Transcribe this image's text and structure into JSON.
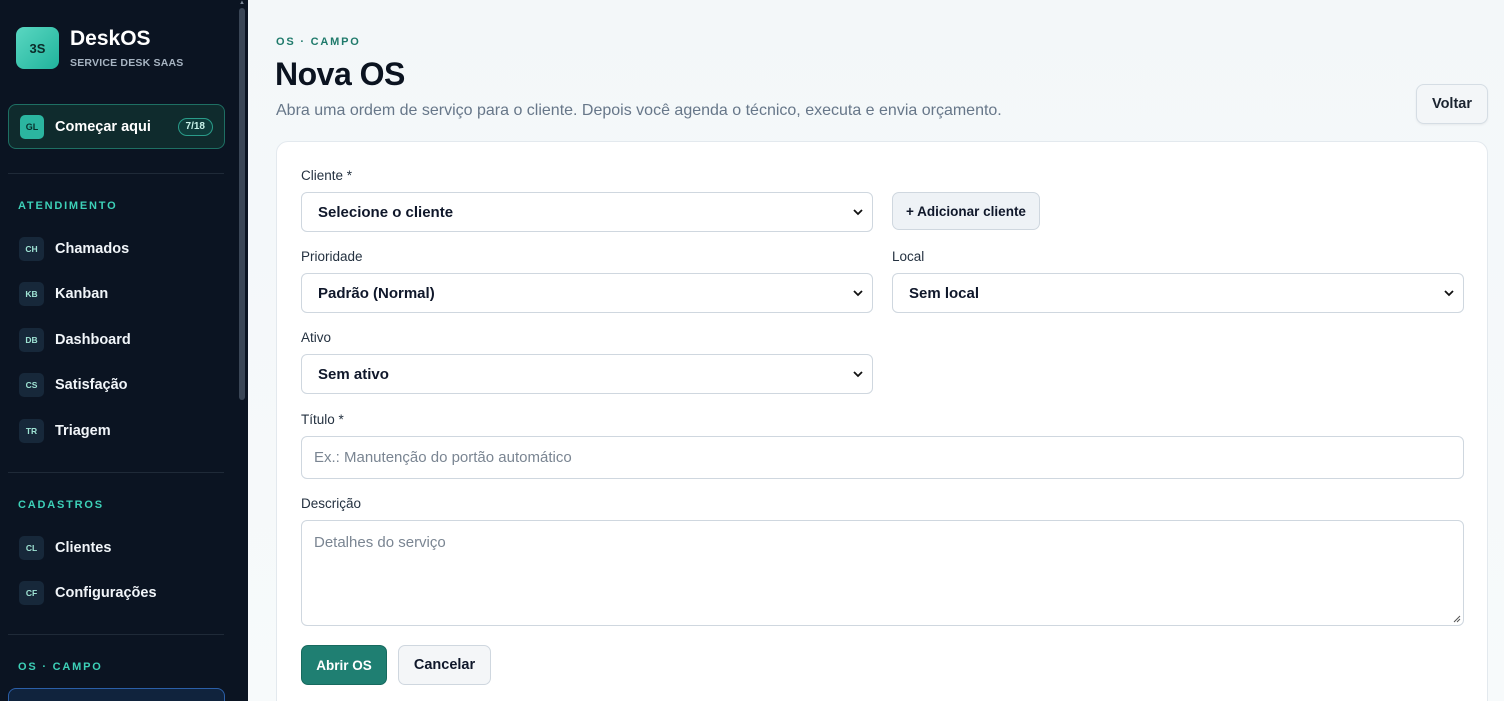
{
  "sidebar": {
    "brand": {
      "logo_text": "3S",
      "name": "DeskOS",
      "subtitle": "SERVICE DESK SAAS"
    },
    "start": {
      "badge": "GL",
      "label": "Começar aqui",
      "count": "7/18"
    },
    "sections": [
      {
        "title": "ATENDIMENTO",
        "items": [
          {
            "abbr": "CH",
            "label": "Chamados"
          },
          {
            "abbr": "KB",
            "label": "Kanban"
          },
          {
            "abbr": "DB",
            "label": "Dashboard"
          },
          {
            "abbr": "CS",
            "label": "Satisfação"
          },
          {
            "abbr": "TR",
            "label": "Triagem"
          }
        ]
      },
      {
        "title": "CADASTROS",
        "items": [
          {
            "abbr": "CL",
            "label": "Clientes"
          },
          {
            "abbr": "CF",
            "label": "Configurações"
          }
        ]
      },
      {
        "title": "OS · CAMPO",
        "items": []
      }
    ]
  },
  "header": {
    "eyebrow": "OS · CAMPO",
    "title": "Nova OS",
    "subtitle": "Abra uma ordem de serviço para o cliente. Depois você agenda o técnico, executa e envia orçamento.",
    "back_label": "Voltar"
  },
  "form": {
    "cliente": {
      "label": "Cliente *",
      "value": "Selecione o cliente",
      "add_label": "+ Adicionar cliente"
    },
    "prioridade": {
      "label": "Prioridade",
      "value": "Padrão (Normal)"
    },
    "local": {
      "label": "Local",
      "value": "Sem local"
    },
    "ativo": {
      "label": "Ativo",
      "value": "Sem ativo"
    },
    "titulo": {
      "label": "Título *",
      "placeholder": "Ex.: Manutenção do portão automático"
    },
    "descricao": {
      "label": "Descrição",
      "placeholder": "Detalhes do serviço"
    },
    "submit_label": "Abrir OS",
    "cancel_label": "Cancelar"
  },
  "colors": {
    "accent": "#1f7f72",
    "sidebar_bg": "#0b1422",
    "section_title": "#3dd1b8"
  }
}
